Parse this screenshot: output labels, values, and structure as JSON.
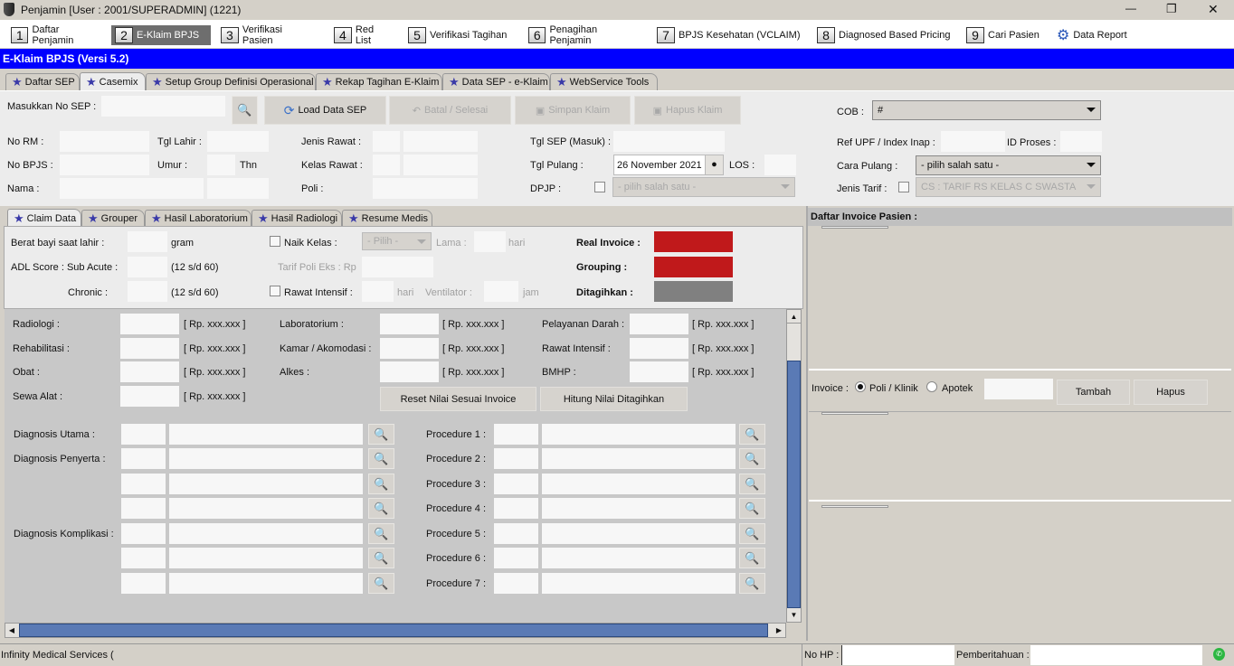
{
  "window": {
    "title": "Penjamin  [User : 2001/SUPERADMIN] (1221)",
    "minimize": "—",
    "maximize": "❐",
    "close": "✕"
  },
  "menu": [
    {
      "num": "1",
      "label": "Daftar Penjamin"
    },
    {
      "num": "2",
      "label": "E-Klaim BPJS",
      "selected": true
    },
    {
      "num": "3",
      "label": "Verifikasi Pasien"
    },
    {
      "num": "4",
      "label": "Red List"
    },
    {
      "num": "5",
      "label": "Verifikasi Tagihan"
    },
    {
      "num": "6",
      "label": "Penagihan Penjamin"
    },
    {
      "num": "7",
      "label": "BPJS Kesehatan (VCLAIM)"
    },
    {
      "num": "8",
      "label": "Diagnosed Based Pricing"
    },
    {
      "num": "9",
      "label": "Cari Pasien"
    }
  ],
  "data_report": "Data Report",
  "module_title": "E-Klaim BPJS (Versi 5.2)",
  "colors": {
    "module_bar": "#0000ff",
    "real_invoice": "#c0191b",
    "grouping": "#c0191b",
    "ditagihkan": "#808080",
    "scroll_thumb": "#5a7ab5"
  },
  "tabs": [
    "Daftar SEP",
    "Casemix",
    "Setup Group Definisi Operasional",
    "Rekap Tagihan E-Klaim",
    "Data SEP - e-Klaim",
    "WebService Tools"
  ],
  "active_tab": "Casemix",
  "toolbar": {
    "no_sep_label": "Masukkan No SEP :",
    "no_sep_value": "",
    "load": "Load Data SEP",
    "batal": "Batal / Selesai",
    "simpan": "Simpan Klaim",
    "hapus": "Hapus Klaim"
  },
  "patient": {
    "no_rm": "No RM :",
    "tgl_lahir": "Tgl Lahir :",
    "jenis_rawat": "Jenis Rawat :",
    "tgl_sep": "Tgl SEP (Masuk) :",
    "no_bpjs": "No BPJS :",
    "umur": "Umur :",
    "thn": "Thn",
    "kelas_rawat": "Kelas Rawat :",
    "tgl_pulang": "Tgl Pulang :",
    "tgl_pulang_value": "26 November 2021",
    "los": "LOS :",
    "nama": "Nama :",
    "poli": "Poli :",
    "dpjp": "DPJP :",
    "dpjp_value": "- pilih salah satu -"
  },
  "right_form": {
    "cob": "COB :",
    "cob_value": "#",
    "ref_upf": "Ref UPF / Index Inap :",
    "id_proses": "ID Proses :",
    "cara_pulang": "Cara Pulang :",
    "cara_pulang_value": "- pilih salah satu -",
    "jenis_tarif": "Jenis Tarif :",
    "jenis_tarif_value": "CS : TARIF RS KELAS C SWASTA"
  },
  "subtabs": [
    "Claim Data",
    "Grouper",
    "Hasil Laboratorium",
    "Hasil Radiologi",
    "Resume Medis"
  ],
  "claim": {
    "berat": "Berat bayi saat lahir :",
    "gram": "gram",
    "naik_kelas": "Naik Kelas :",
    "pilih": "- Pilih -",
    "lama": "Lama :",
    "hari": "hari",
    "adl": "ADL Score :  Sub Acute :",
    "range": "(12 s/d 60)",
    "tarif_poli": "Tarif Poli Eks : Rp",
    "chronic": "Chronic :",
    "rawat_intensif": "Rawat Intensif :",
    "ventilator": "Ventilator :",
    "jam": "jam",
    "real_invoice": "Real Invoice :",
    "grouping": "Grouping :",
    "ditagihkan": "Ditagihkan :"
  },
  "costs": [
    [
      "Radiologi :",
      "Laboratorium :",
      "Pelayanan Darah :"
    ],
    [
      "Rehabilitasi :",
      "Kamar / Akomodasi :",
      "Rawat Intensif :"
    ],
    [
      "Obat :",
      "Alkes :",
      "BMHP :"
    ],
    [
      "Sewa Alat :"
    ]
  ],
  "cost_hint": "[ Rp. xxx.xxx ]",
  "reset_btn": "Reset Nilai Sesuai Invoice",
  "hitung_btn": "Hitung Nilai Ditagihkan",
  "diagnosis_labels": [
    "Diagnosis Utama :",
    "Diagnosis Penyerta :",
    "",
    "",
    "Diagnosis Komplikasi :",
    "",
    ""
  ],
  "procedures": [
    "Procedure 1 :",
    "Procedure 2 :",
    "Procedure 3 :",
    "Procedure 4 :",
    "Procedure 5 :",
    "Procedure 6 :",
    "Procedure 7 :"
  ],
  "invoice": {
    "title": "Daftar Invoice Pasien :",
    "label": "Invoice :",
    "opt1": "Poli / Klinik",
    "opt2": "Apotek",
    "selected": "Poli / Klinik",
    "tambah": "Tambah",
    "hapus": "Hapus"
  },
  "status": {
    "left": "Infinity Medical Services (",
    "no_hp": "No HP :",
    "pemberitahuan": "Pemberitahuan :"
  }
}
